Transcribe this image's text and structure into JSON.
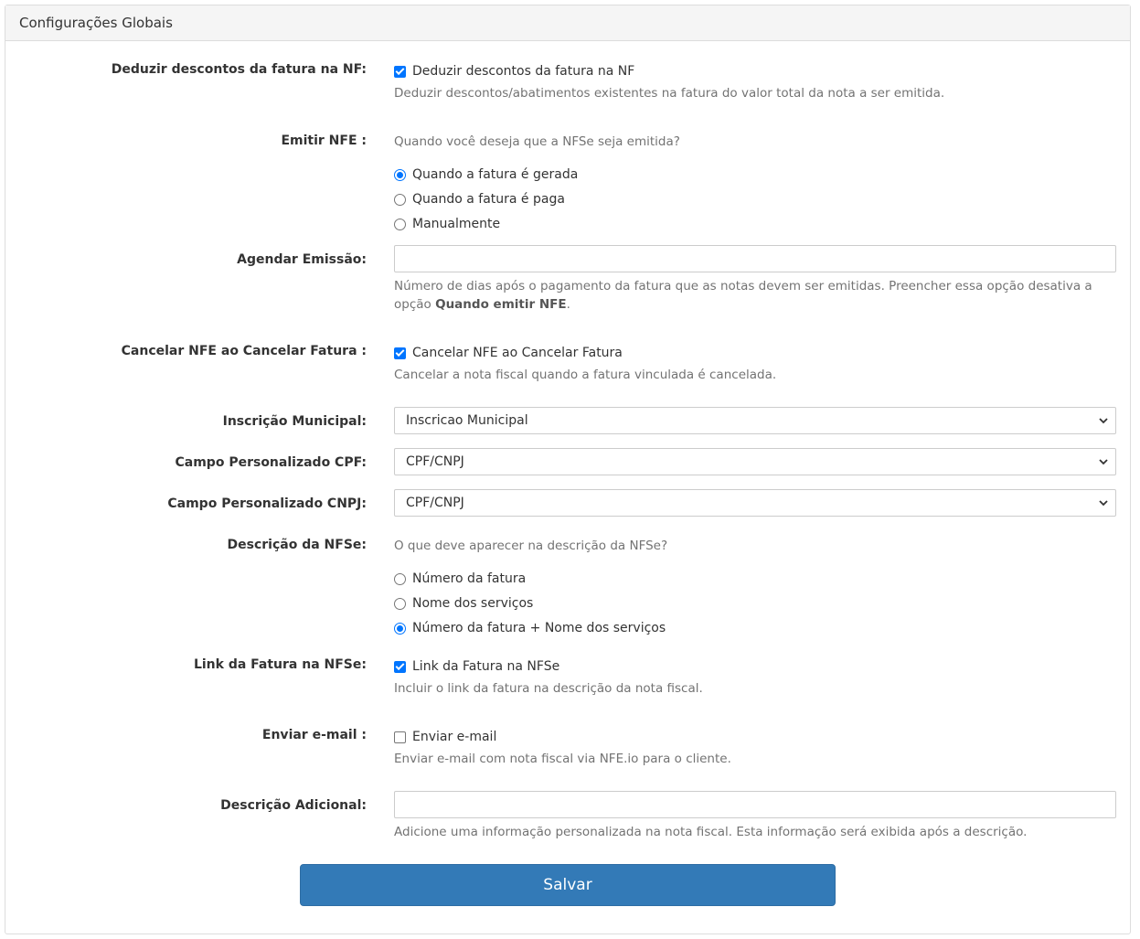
{
  "panel": {
    "title": "Configurações Globais"
  },
  "deduzir": {
    "label": "Deduzir descontos da fatura na NF:",
    "checkbox_label": "Deduzir descontos da fatura na NF",
    "checked": true,
    "help": "Deduzir descontos/abatimentos existentes na fatura do valor total da nota a ser emitida."
  },
  "emitir": {
    "label": "Emitir NFE :",
    "question": "Quando você deseja que a NFSe seja emitida?",
    "options": [
      "Quando a fatura é gerada",
      "Quando a fatura é paga",
      "Manualmente"
    ],
    "selected": 0
  },
  "agendar": {
    "label": "Agendar Emissão:",
    "value": "",
    "help_text": "Número de dias após o pagamento da fatura que as notas devem ser emitidas. Preencher essa opção desativa a opção",
    "help_bold": "Quando emitir NFE",
    "help_end": "."
  },
  "cancelar": {
    "label": "Cancelar NFE ao Cancelar Fatura :",
    "checkbox_label": "Cancelar NFE ao Cancelar Fatura",
    "checked": true,
    "help": "Cancelar a nota fiscal quando a fatura vinculada é cancelada."
  },
  "inscricao": {
    "label": "Inscrição Municipal:",
    "selected": "Inscricao Municipal"
  },
  "campo_cpf": {
    "label": "Campo Personalizado CPF:",
    "selected": "CPF/CNPJ"
  },
  "campo_cnpj": {
    "label": "Campo Personalizado CNPJ:",
    "selected": "CPF/CNPJ"
  },
  "descricao": {
    "label": "Descrição da NFSe:",
    "question": "O que deve aparecer na descrição da NFSe?",
    "options": [
      "Número da fatura",
      "Nome dos serviços",
      "Número da fatura + Nome dos serviços"
    ],
    "selected": 2
  },
  "link": {
    "label": "Link da Fatura na NFSe:",
    "checkbox_label": "Link da Fatura na NFSe",
    "checked": true,
    "help": "Incluir o link da fatura na descrição da nota fiscal."
  },
  "email": {
    "label": "Enviar e-mail :",
    "checkbox_label": "Enviar e-mail",
    "checked": false,
    "help": "Enviar e-mail com nota fiscal via NFE.io para o cliente."
  },
  "adicional": {
    "label": "Descrição Adicional:",
    "value": "",
    "help": "Adicione uma informação personalizada na nota fiscal. Esta informação será exibida após a descrição."
  },
  "save_label": "Salvar",
  "colors": {
    "primary": "#337ab7",
    "checkbox_accent": "#0075ff",
    "help_text": "#737373"
  }
}
